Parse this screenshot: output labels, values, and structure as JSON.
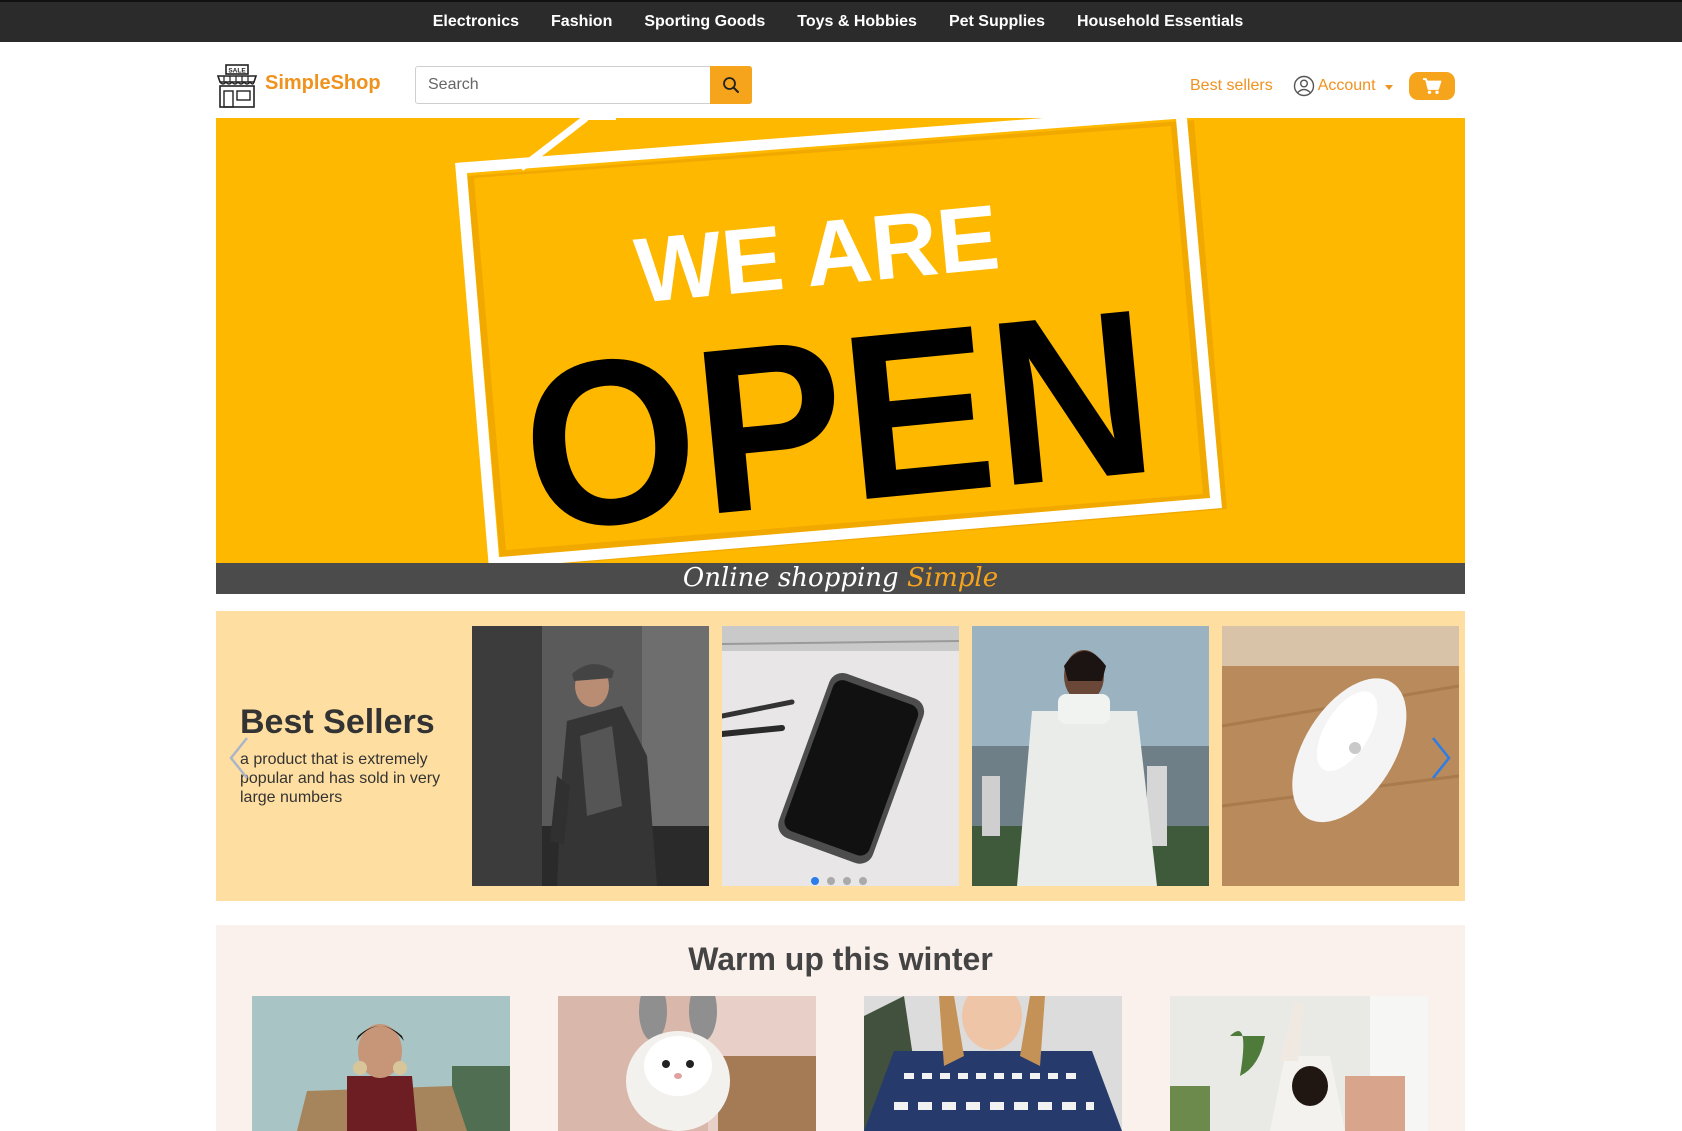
{
  "categories": [
    "Electronics",
    "Fashion",
    "Sporting Goods",
    "Toys & Hobbies",
    "Pet Supplies",
    "Household Essentials"
  ],
  "logo": {
    "badge": "SALE",
    "text": "SimpleShop"
  },
  "search": {
    "placeholder": "Search"
  },
  "nav": {
    "best_sellers": "Best sellers",
    "account": "Account"
  },
  "hero": {
    "sign_line1": "WE ARE",
    "sign_line2": "OPEN",
    "caption_prefix": "Online shopping ",
    "caption_accent": "Simple"
  },
  "best_sellers": {
    "title": "Best Sellers",
    "description": "a product that is extremely popular and has sold in very large numbers",
    "products": [
      "man-in-coat-photo",
      "smartphone-photo",
      "woman-white-coat-photo",
      "wireless-mouse-photo"
    ],
    "carousel_pages": 4,
    "active_page": 1
  },
  "winter": {
    "title": "Warm up this winter",
    "items": [
      "woman-trench-coat-photo",
      "plush-bunny-photo",
      "holiday-sweater-photo",
      "stretching-woman-photo"
    ]
  },
  "colors": {
    "accent": "#f7a41d",
    "brand": "#f0921e",
    "hero_bg": "#ffb800",
    "best_bg": "#ffdfa1"
  }
}
